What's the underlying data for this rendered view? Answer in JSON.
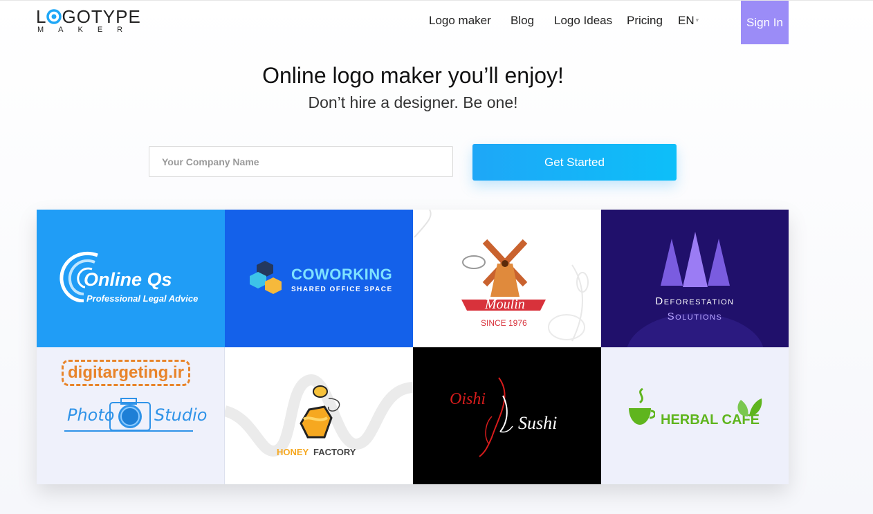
{
  "brand": {
    "word_top": "LOGOTYPE",
    "word_bottom": "MAKER"
  },
  "nav": {
    "logo_maker": "Logo maker",
    "blog": "Blog",
    "logo_ideas": "Logo Ideas",
    "pricing": "Pricing",
    "language": "EN",
    "sign_in": "Sign In"
  },
  "hero": {
    "title": "Online logo maker you’ll enjoy!",
    "subtitle": "Don’t hire a designer. Be one!"
  },
  "form": {
    "placeholder": "Your Company Name",
    "button": "Get Started"
  },
  "colors": {
    "accent": "#1ea7f7",
    "signin_bg": "#9b8cf7"
  },
  "examples": [
    {
      "name": "Online Qs",
      "tagline": "Professional Legal Advice",
      "bg": "#209df6",
      "icon": "swirl-icon"
    },
    {
      "name": "COWORKING",
      "tagline": "SHARED OFFICE SPACE",
      "bg": "#1461ea",
      "icon": "cubes-icon"
    },
    {
      "name": "Moulin",
      "tagline": "SINCE 1976",
      "bg": "#ffffff",
      "icon": "windmill-icon"
    },
    {
      "name": "Deforestation",
      "tagline": "Solutions",
      "bg": "#20106b",
      "icon": "trees-icon"
    },
    {
      "name": "digitargeting.ir",
      "tagline_left": "Photo",
      "tagline_right": "Studio",
      "bg": "#eff1fb",
      "icon": "camera-icon"
    },
    {
      "name_a": "HONEY",
      "name_b": "FACTORY",
      "bg": "#ffffff",
      "icon": "bee-icon"
    },
    {
      "name_a": "Oishi",
      "name_b": "Sushi",
      "bg": "#000000",
      "icon": "fish-icon"
    },
    {
      "name": "HERBAL CAFE",
      "bg": "#eef0fb",
      "icon": "cup-icon"
    }
  ]
}
